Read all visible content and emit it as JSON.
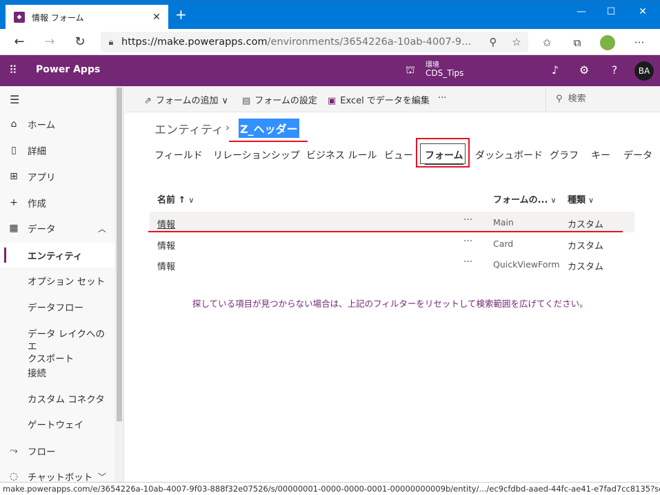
{
  "browser": {
    "tab_title": "情報 フォーム",
    "new_tab": "+",
    "close": "✕",
    "url_main": "https://make.powerapps.com",
    "url_rest": "/environments/3654226a-10ab-4007-9...",
    "status_url": "make.powerapps.com/e/3654226a-10ab-4007-9f03-888f32e07526/s/00000001-0000-0000-0001-00000000009b/entity/.../ec9cfdbd-aaed-44fc-ae41-e7fad7cc8135?source..."
  },
  "app": {
    "name": "Power Apps",
    "env_label": "環境",
    "env_name": "CDS_Tips",
    "avatar": "BA",
    "accent": "#742774"
  },
  "nav": {
    "items": [
      {
        "label": "ホーム",
        "icon": "home-icon"
      },
      {
        "label": "詳細",
        "icon": "book-icon"
      },
      {
        "label": "アプリ",
        "icon": "apps-icon"
      },
      {
        "label": "作成",
        "icon": "plus-icon"
      },
      {
        "label": "データ",
        "icon": "table-icon"
      }
    ],
    "sub_items": [
      "エンティティ",
      "オプション セット",
      "データフロー"
    ],
    "multiline_item": [
      "データ レイクへのエ",
      "クスポート"
    ],
    "more_items": [
      "接続",
      "カスタム コネクタ",
      "ゲートウェイ"
    ],
    "flow": "フロー",
    "chatbot": "チャットボット"
  },
  "commands": {
    "add_form": "フォームの追加",
    "form_settings": "フォームの設定",
    "excel_edit": "Excel でデータを編集",
    "more": "···",
    "search": "検索"
  },
  "breadcrumb": {
    "parent": "エンティティ",
    "sep": "›",
    "current": "Z_ヘッダー"
  },
  "tabs": [
    "フィールド",
    "リレーションシップ",
    "ビジネス ルール",
    "ビュー",
    "フォーム",
    "ダッシュボード",
    "グラフ",
    "キー",
    "データ"
  ],
  "table": {
    "headers": {
      "name": "名前 ↑",
      "form_type": "フォームの...",
      "kind": "種類"
    },
    "rows": [
      {
        "name": "情報",
        "dots": "···",
        "form_type": "Main",
        "kind": "カスタム"
      },
      {
        "name": "情報",
        "dots": "···",
        "form_type": "Card",
        "kind": "カスタム"
      },
      {
        "name": "情報",
        "dots": "···",
        "form_type": "QuickViewForm",
        "kind": "カスタム"
      }
    ]
  },
  "empty_message": "探している項目が見つからない場合は、上記のフィルターをリセットして検索範囲を広げてください。"
}
